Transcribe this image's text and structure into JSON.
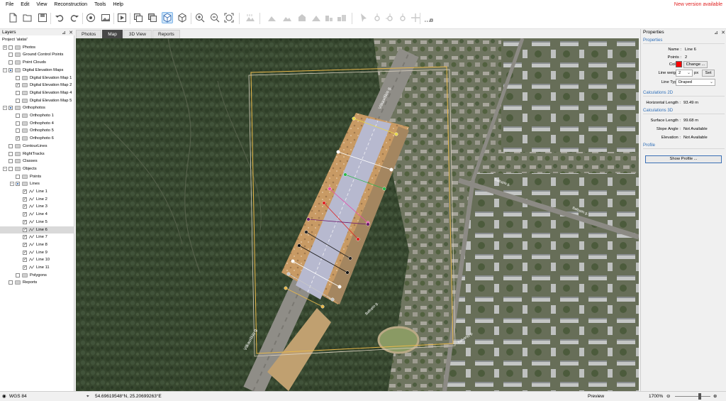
{
  "menu": [
    "File",
    "Edit",
    "View",
    "Reconstruction",
    "Tools",
    "Help"
  ],
  "new_version": "New version available",
  "toolbar_icons": [
    "new-icon",
    "open-icon",
    "save-icon",
    "undo-icon",
    "redo-icon",
    "camera-icon",
    "image-icon",
    "play-icon",
    "orthophoto-icon",
    "dem-icon",
    "3d-box-active-icon",
    "3d-box-icon",
    "zoom-in-icon",
    "zoom-out-icon",
    "zoom-fit-icon",
    "terrain-icon",
    "mountain-icon",
    "mountain-2-icon",
    "house-icon",
    "house-2-icon",
    "buildings-icon",
    "buildings-2-icon",
    "select-point-icon",
    "add-point-icon",
    "add-line-icon",
    "line-icon",
    "move-icon",
    "measure-icon"
  ],
  "layers": {
    "title": "Layers",
    "items": [
      {
        "label": "Project 'alatai'",
        "level": 0,
        "expander": "",
        "checkbox": "none",
        "icon": "none"
      },
      {
        "label": "Photos",
        "level": 0,
        "expander": "+",
        "checkbox": "empty",
        "icon": "folder"
      },
      {
        "label": "Ground Control Points",
        "level": 0,
        "expander": "",
        "checkbox": "empty",
        "icon": "folder"
      },
      {
        "label": "Point Clouds",
        "level": 0,
        "expander": "",
        "checkbox": "empty",
        "icon": "folder"
      },
      {
        "label": "Digital Elevation Maps",
        "level": 0,
        "expander": "-",
        "checkbox": "partial",
        "icon": "folder"
      },
      {
        "label": "Digital Elevation Map 1",
        "level": 1,
        "expander": "",
        "checkbox": "empty",
        "icon": "folder"
      },
      {
        "label": "Digital Elevation Map 2",
        "level": 1,
        "expander": "",
        "checkbox": "checked",
        "icon": "folder"
      },
      {
        "label": "Digital Elevation Map 4",
        "level": 1,
        "expander": "",
        "checkbox": "empty",
        "icon": "folder"
      },
      {
        "label": "Digital Elevation Map 5",
        "level": 1,
        "expander": "",
        "checkbox": "empty",
        "icon": "folder"
      },
      {
        "label": "Orthophotos",
        "level": 0,
        "expander": "-",
        "checkbox": "partial",
        "icon": "folder"
      },
      {
        "label": "Orthophoto 1",
        "level": 1,
        "expander": "",
        "checkbox": "empty",
        "icon": "folder"
      },
      {
        "label": "Orthophoto 4",
        "level": 1,
        "expander": "",
        "checkbox": "empty",
        "icon": "folder"
      },
      {
        "label": "Orthophoto 5",
        "level": 1,
        "expander": "",
        "checkbox": "empty",
        "icon": "folder"
      },
      {
        "label": "Orthophoto 6",
        "level": 1,
        "expander": "",
        "checkbox": "checked",
        "icon": "folder"
      },
      {
        "label": "ContourLines",
        "level": 0,
        "expander": "",
        "checkbox": "empty",
        "icon": "folder"
      },
      {
        "label": "RightTracks",
        "level": 0,
        "expander": "",
        "checkbox": "empty",
        "icon": "folder"
      },
      {
        "label": "Classes",
        "level": 0,
        "expander": "",
        "checkbox": "empty",
        "icon": "folder"
      },
      {
        "label": "Objects",
        "level": 0,
        "expander": "-",
        "checkbox": "empty",
        "icon": "folder"
      },
      {
        "label": "Points",
        "level": 1,
        "expander": "",
        "checkbox": "empty",
        "icon": "folder"
      },
      {
        "label": "Lines",
        "level": 1,
        "expander": "-",
        "checkbox": "partial",
        "icon": "folder"
      },
      {
        "label": "Line 1",
        "level": 2,
        "expander": "",
        "checkbox": "checked",
        "icon": "line"
      },
      {
        "label": "Line 2",
        "level": 2,
        "expander": "",
        "checkbox": "checked",
        "icon": "line"
      },
      {
        "label": "Line 3",
        "level": 2,
        "expander": "",
        "checkbox": "checked",
        "icon": "line"
      },
      {
        "label": "Line 4",
        "level": 2,
        "expander": "",
        "checkbox": "checked",
        "icon": "line"
      },
      {
        "label": "Line 5",
        "level": 2,
        "expander": "",
        "checkbox": "checked",
        "icon": "line"
      },
      {
        "label": "Line 6",
        "level": 2,
        "expander": "",
        "checkbox": "checked",
        "icon": "line",
        "selected": true
      },
      {
        "label": "Line 7",
        "level": 2,
        "expander": "",
        "checkbox": "checked",
        "icon": "line"
      },
      {
        "label": "Line 8",
        "level": 2,
        "expander": "",
        "checkbox": "checked",
        "icon": "line"
      },
      {
        "label": "Line 9",
        "level": 2,
        "expander": "",
        "checkbox": "checked",
        "icon": "line"
      },
      {
        "label": "Line 10",
        "level": 2,
        "expander": "",
        "checkbox": "checked",
        "icon": "line"
      },
      {
        "label": "Line 11",
        "level": 2,
        "expander": "",
        "checkbox": "checked",
        "icon": "line"
      },
      {
        "label": "Polygons",
        "level": 1,
        "expander": "",
        "checkbox": "empty",
        "icon": "folder"
      },
      {
        "label": "Reports",
        "level": 0,
        "expander": "",
        "checkbox": "empty",
        "icon": "folder"
      }
    ]
  },
  "tabs": [
    {
      "label": "Photos",
      "active": false
    },
    {
      "label": "Map",
      "active": true
    },
    {
      "label": "3D View",
      "active": false
    },
    {
      "label": "Reports",
      "active": false
    }
  ],
  "map": {
    "street_labels": [
      "Vilkaviškio g.",
      "Vilkaviškio g.",
      "Baltupio g.",
      "Baltupio g.",
      "Baltupio g.",
      "Kalvarijų g."
    ],
    "line_colors": [
      "#e8d84a",
      "#ffffff",
      "#2db84a",
      "#e84aa8",
      "#e02020",
      "#6a1a6a",
      "#222222",
      "#111111",
      "#ffffff",
      "#c8c8c8",
      "#e8b84a"
    ]
  },
  "properties": {
    "title": "Properties",
    "section_properties": "Properties",
    "name_label": "Name :",
    "name_value": "Line 6",
    "points_label": "Points :",
    "points_value": "2",
    "color_label": "Color :",
    "color_value": "#ff0000",
    "change_button": "Change ...",
    "line_weight_label": "Line weight :",
    "line_weight_value": "2",
    "line_weight_unit": "px",
    "set_button": "Set",
    "line_type_label": "Line Type :",
    "line_type_value": "Draped",
    "section_calc2d": "Calculations 2D",
    "horizontal_label": "Horizontal Length :",
    "horizontal_value": "93.49 m",
    "section_calc3d": "Calculations 3D",
    "surface_label": "Surface Length :",
    "surface_value": "99.68 m",
    "slope_label": "Slope Angle :",
    "slope_value": "Not Available",
    "elevation_label": "Elevation :",
    "elevation_value": "Not Available",
    "section_profile": "Profile",
    "show_profile_button": "Show Profile ..."
  },
  "status": {
    "crs": "WGS 84",
    "coords": "54.69619548°N, 25.20699263°E",
    "preview": "Preview",
    "zoom": "1700%"
  }
}
